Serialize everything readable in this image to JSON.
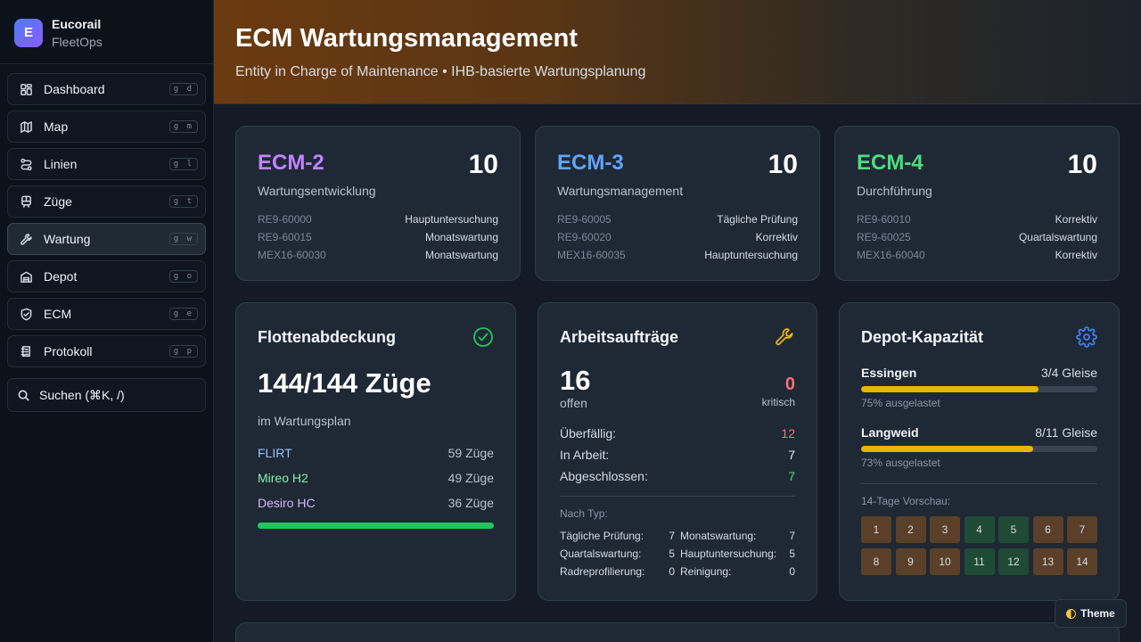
{
  "brand": {
    "logo_letter": "E",
    "name": "Eucorail",
    "subtitle": "FleetOps"
  },
  "nav": {
    "items": [
      {
        "label": "Dashboard",
        "shortcut": "g d",
        "icon": "dashboard-icon"
      },
      {
        "label": "Map",
        "shortcut": "g m",
        "icon": "map-icon"
      },
      {
        "label": "Linien",
        "shortcut": "g l",
        "icon": "route-icon"
      },
      {
        "label": "Züge",
        "shortcut": "g t",
        "icon": "train-icon"
      },
      {
        "label": "Wartung",
        "shortcut": "g w",
        "icon": "wrench-icon",
        "active": true
      },
      {
        "label": "Depot",
        "shortcut": "g o",
        "icon": "depot-icon"
      },
      {
        "label": "ECM",
        "shortcut": "g e",
        "icon": "shield-icon"
      },
      {
        "label": "Protokoll",
        "shortcut": "g p",
        "icon": "log-icon"
      }
    ],
    "search_label": "Suchen (⌘K, /)"
  },
  "header": {
    "title": "ECM Wartungsmanagement",
    "subtitle": "Entity in Charge of Maintenance • IHB-basierte Wartungsplanung"
  },
  "ecm_cards": [
    {
      "title": "ECM-2",
      "count": "10",
      "subtitle": "Wartungsentwicklung",
      "color": "#c084fc",
      "rows": [
        {
          "id": "RE9-60000",
          "type": "Hauptuntersuchung"
        },
        {
          "id": "RE9-60015",
          "type": "Monatswartung"
        },
        {
          "id": "MEX16-60030",
          "type": "Monatswartung"
        }
      ]
    },
    {
      "title": "ECM-3",
      "count": "10",
      "subtitle": "Wartungsmanagement",
      "color": "#60a5fa",
      "rows": [
        {
          "id": "RE9-60005",
          "type": "Tägliche Prüfung"
        },
        {
          "id": "RE9-60020",
          "type": "Korrektiv"
        },
        {
          "id": "MEX16-60035",
          "type": "Hauptuntersuchung"
        }
      ]
    },
    {
      "title": "ECM-4",
      "count": "10",
      "subtitle": "Durchführung",
      "color": "#4ade80",
      "rows": [
        {
          "id": "RE9-60010",
          "type": "Korrektiv"
        },
        {
          "id": "RE9-60025",
          "type": "Quartalswartung"
        },
        {
          "id": "MEX16-60040",
          "type": "Korrektiv"
        }
      ]
    }
  ],
  "fleet": {
    "title": "Flottenabdeckung",
    "total": "144/144 Züge",
    "subtitle": "im Wartungsplan",
    "coverage": 1.0,
    "rows": [
      {
        "name": "FLIRT",
        "count": "59 Züge",
        "color": "#93c5fd"
      },
      {
        "name": "Mireo H2",
        "count": "49 Züge",
        "color": "#86efac"
      },
      {
        "name": "Desiro HC",
        "count": "36 Züge",
        "color": "#d8b4fe"
      }
    ]
  },
  "work_orders": {
    "title": "Arbeitsaufträge",
    "open_count": "16",
    "open_label": "offen",
    "critical_count": "0",
    "critical_label": "kritisch",
    "rows": [
      {
        "label": "Überfällig:",
        "value": "12",
        "color": "#f87171"
      },
      {
        "label": "In Arbeit:",
        "value": "7",
        "color": "#e6ebf2"
      },
      {
        "label": "Abgeschlossen:",
        "value": "7",
        "color": "#4ade80"
      }
    ],
    "types_title": "Nach Typ:",
    "types": [
      {
        "label": "Tägliche Prüfung:",
        "value": "7"
      },
      {
        "label": "Monatswartung:",
        "value": "7"
      },
      {
        "label": "Quartalswartung:",
        "value": "5"
      },
      {
        "label": "Hauptuntersuchung:",
        "value": "5"
      },
      {
        "label": "Radreprofilierung:",
        "value": "0"
      },
      {
        "label": "Reinigung:",
        "value": "0"
      }
    ]
  },
  "depot": {
    "title": "Depot-Kapazität",
    "depots": [
      {
        "name": "Essingen",
        "tracks": "3/4 Gleise",
        "utilization_label": "75% ausgelastet",
        "utilization": 0.75
      },
      {
        "name": "Langweid",
        "tracks": "8/11 Gleise",
        "utilization_label": "73% ausgelastet",
        "utilization": 0.73
      }
    ],
    "preview_title": "14-Tage Vorschau:",
    "days": [
      {
        "label": "1",
        "status": "warn"
      },
      {
        "label": "2",
        "status": "warn"
      },
      {
        "label": "3",
        "status": "warn"
      },
      {
        "label": "4",
        "status": "ok"
      },
      {
        "label": "5",
        "status": "ok"
      },
      {
        "label": "6",
        "status": "warn"
      },
      {
        "label": "7",
        "status": "warn"
      },
      {
        "label": "8",
        "status": "warn"
      },
      {
        "label": "9",
        "status": "warn"
      },
      {
        "label": "10",
        "status": "warn"
      },
      {
        "label": "11",
        "status": "ok"
      },
      {
        "label": "12",
        "status": "ok"
      },
      {
        "label": "13",
        "status": "warn"
      },
      {
        "label": "14",
        "status": "warn"
      }
    ]
  },
  "theme_button": {
    "label": "Theme"
  },
  "colors": {
    "accent_green": "#22c55e",
    "warn_yellow": "#eab308",
    "gear_blue": "#3b82f6",
    "wrench_yellow": "#eab308"
  }
}
